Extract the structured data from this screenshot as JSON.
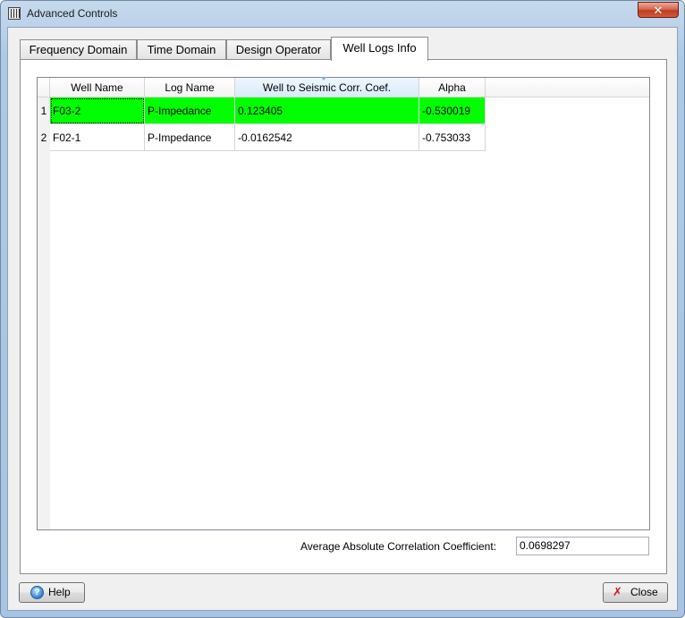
{
  "window": {
    "title": "Advanced Controls",
    "close_glyph": "✕"
  },
  "tabs": [
    {
      "label": "Frequency Domain",
      "active": false
    },
    {
      "label": "Time Domain",
      "active": false
    },
    {
      "label": "Design Operator",
      "active": false
    },
    {
      "label": "Well Logs Info",
      "active": true
    }
  ],
  "table": {
    "columns": [
      "Well Name",
      "Log Name",
      "Well to Seismic Corr. Coef.",
      "Alpha"
    ],
    "sorted_column": "Well to Seismic Corr. Coef.",
    "rows": [
      {
        "num": "1",
        "well": "F03-2",
        "log": "P-Impedance",
        "corr": "0.123405",
        "alpha": "-0.530019",
        "highlight": "#00ff00"
      },
      {
        "num": "2",
        "well": "F02-1",
        "log": "P-Impedance",
        "corr": "-0.0162542",
        "alpha": "-0.753033",
        "highlight": null
      }
    ]
  },
  "summary": {
    "avg_label": "Average Absolute Correlation Coefficient:",
    "avg_value": "0.0698297"
  },
  "buttons": {
    "help": {
      "label": "Help",
      "icon": "help-icon",
      "icon_glyph": "?"
    },
    "close": {
      "label": "Close",
      "icon": "close-icon",
      "icon_glyph": "✗"
    }
  },
  "colors": {
    "highlight": "#00ff00",
    "title_bar": "#bcd2e9"
  }
}
